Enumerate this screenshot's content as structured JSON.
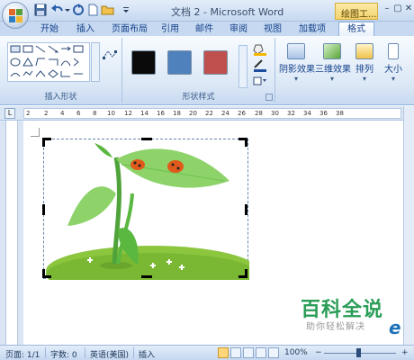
{
  "titlebar": {
    "title": "文档 2 - Microsoft Word",
    "context_tab_group": "绘图工...",
    "minimize": "–",
    "maximize": "▢",
    "close": "✕"
  },
  "tabs": [
    {
      "label": "开始"
    },
    {
      "label": "插入"
    },
    {
      "label": "页面布局"
    },
    {
      "label": "引用"
    },
    {
      "label": "邮件"
    },
    {
      "label": "审阅"
    },
    {
      "label": "视图"
    },
    {
      "label": "加载项"
    },
    {
      "label": "格式",
      "active": true
    }
  ],
  "ribbon": {
    "insert_shapes_label": "插入形状",
    "shape_styles_label": "形状样式",
    "style_swatches": [
      {
        "name": "black-style",
        "color": "#0a0a0a"
      },
      {
        "name": "blue-style",
        "color": "#4f81bd"
      },
      {
        "name": "red-style",
        "color": "#c0504d"
      }
    ],
    "shadow_effect": "阴影效果",
    "3d_effect": "三维效果",
    "arrange": "排列",
    "size": "大小"
  },
  "ruler": {
    "numbers": [
      "2",
      "2",
      "4",
      "6",
      "8",
      "10",
      "12",
      "14",
      "16",
      "18",
      "20",
      "22",
      "24",
      "26",
      "28",
      "30",
      "32",
      "34",
      "36",
      "38"
    ]
  },
  "watermark": {
    "title": "百科全说",
    "subtitle": "助你轻松解决",
    "logo": "e"
  },
  "statusbar": {
    "page": "页面: 1/1",
    "words": "字数: 0",
    "language": "英语(美国)",
    "mode": "插入",
    "zoom": "100%",
    "minus": "−",
    "plus": "+"
  },
  "colors": {
    "accent": "#4f81bd",
    "context_tab": "#f3d36d",
    "watermark_green": "#2a9d57"
  }
}
